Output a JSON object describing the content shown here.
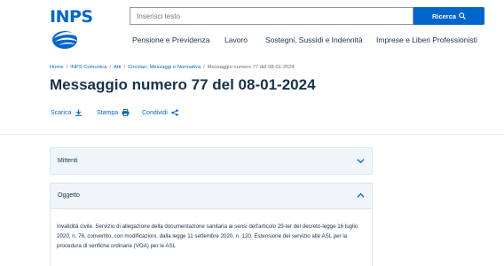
{
  "brand": {
    "logo_text": "INPS"
  },
  "search": {
    "placeholder": "Inserisci testo",
    "button_label": "Ricerca"
  },
  "nav": [
    {
      "label": "Pensione e Previdenza"
    },
    {
      "label": "Lavoro"
    },
    {
      "label": "Sostegni, Sussidi e Indennità"
    },
    {
      "label": "Imprese e Liberi Professionisti"
    }
  ],
  "breadcrumb": [
    {
      "label": "Home"
    },
    {
      "label": "INPS Comunica"
    },
    {
      "label": "Atti"
    },
    {
      "label": "Circolari, Messaggi e Normativa"
    },
    {
      "label": "Messaggio numero 77 del 08-01-2024"
    }
  ],
  "page": {
    "title": "Messaggio numero 77 del 08-01-2024"
  },
  "actions": [
    {
      "label": "Scarica",
      "icon": "download-icon"
    },
    {
      "label": "Stampa",
      "icon": "print-icon"
    },
    {
      "label": "Condividi",
      "icon": "share-icon"
    }
  ],
  "accordions": [
    {
      "label": "Mittenti",
      "state": "collapsed"
    },
    {
      "label": "Oggetto",
      "state": "expanded"
    }
  ],
  "oggetto_text": "Invalidità civile. Servizio di allegazione della documentazione sanitaria ai sensi dell'articolo 29-ter del decreto-legge 16 luglio 2020, n. 76, convertito, con modificazioni, dalla legge 11 settembre 2020, n. 120. Estensione del servizio alle ASL per la procedura di verifiche ordinarie (VOA) per le ASL",
  "colors": {
    "accent": "#0066cc",
    "text": "#17324d",
    "accordion_bg": "#f0f5fa"
  }
}
